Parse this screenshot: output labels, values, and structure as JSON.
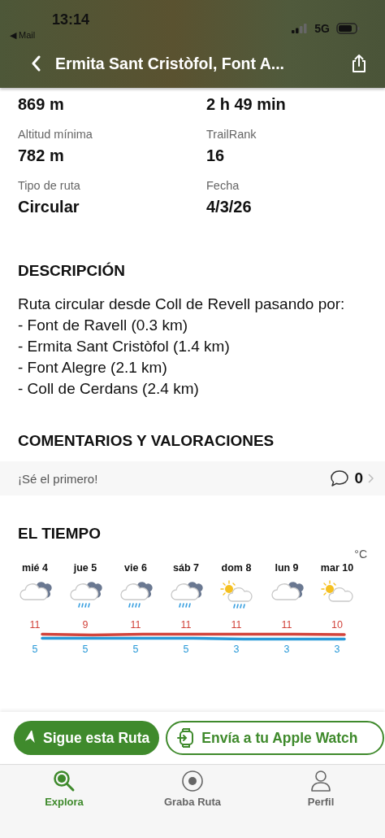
{
  "status_bar": {
    "time": "13:14",
    "back_app": "◀ Mail",
    "network": "5G"
  },
  "header": {
    "title": "Ermita Sant Cristòfol, Font A..."
  },
  "stats": [
    {
      "value": "869 m"
    },
    {
      "value": "2 h 49 min"
    },
    {
      "label": "Altitud mínima",
      "value": "782 m"
    },
    {
      "label": "TrailRank",
      "value": "16"
    },
    {
      "label": "Tipo de ruta",
      "value": "Circular"
    },
    {
      "label": "Fecha",
      "value": "4/3/26"
    }
  ],
  "description": {
    "heading": "DESCRIPCIÓN",
    "lines": [
      "Ruta circular desde Coll de Revell pasando por:",
      "- Font de Ravell (0.3 km)",
      "- Ermita Sant Cristòfol (1.4 km)",
      "- Font Alegre (2.1 km)",
      "- Coll de Cerdans (2.4 km)"
    ]
  },
  "comments": {
    "heading": "COMENTARIOS Y VALORACIONES",
    "prompt": "¡Sé el primero!",
    "count": "0"
  },
  "weather": {
    "heading": "EL TIEMPO",
    "unit": "°C",
    "days": [
      {
        "day": "mié 4",
        "kind": "cloudy",
        "high": "11",
        "low": "5"
      },
      {
        "day": "jue 5",
        "kind": "cloud-rain",
        "high": "9",
        "low": "5"
      },
      {
        "day": "vie 6",
        "kind": "cloud-rain",
        "high": "11",
        "low": "5"
      },
      {
        "day": "sáb 7",
        "kind": "cloud-rain",
        "high": "11",
        "low": "5"
      },
      {
        "day": "dom 8",
        "kind": "sun-rain",
        "high": "11",
        "low": "3"
      },
      {
        "day": "lun 9",
        "kind": "cloudy",
        "high": "11",
        "low": "3"
      },
      {
        "day": "mar 10",
        "kind": "sun-cloud",
        "high": "10",
        "low": "3"
      }
    ]
  },
  "actions": [
    {
      "label": "Sigue esta Ruta",
      "kind": "primary"
    },
    {
      "label": "Envía a tu Apple Watch",
      "kind": "outline"
    }
  ],
  "tabs": [
    {
      "label": "Explora",
      "kind": "search",
      "selected": true
    },
    {
      "label": "Graba Ruta",
      "kind": "record",
      "selected": false
    },
    {
      "label": "Perfil",
      "kind": "profile",
      "selected": false
    }
  ]
}
